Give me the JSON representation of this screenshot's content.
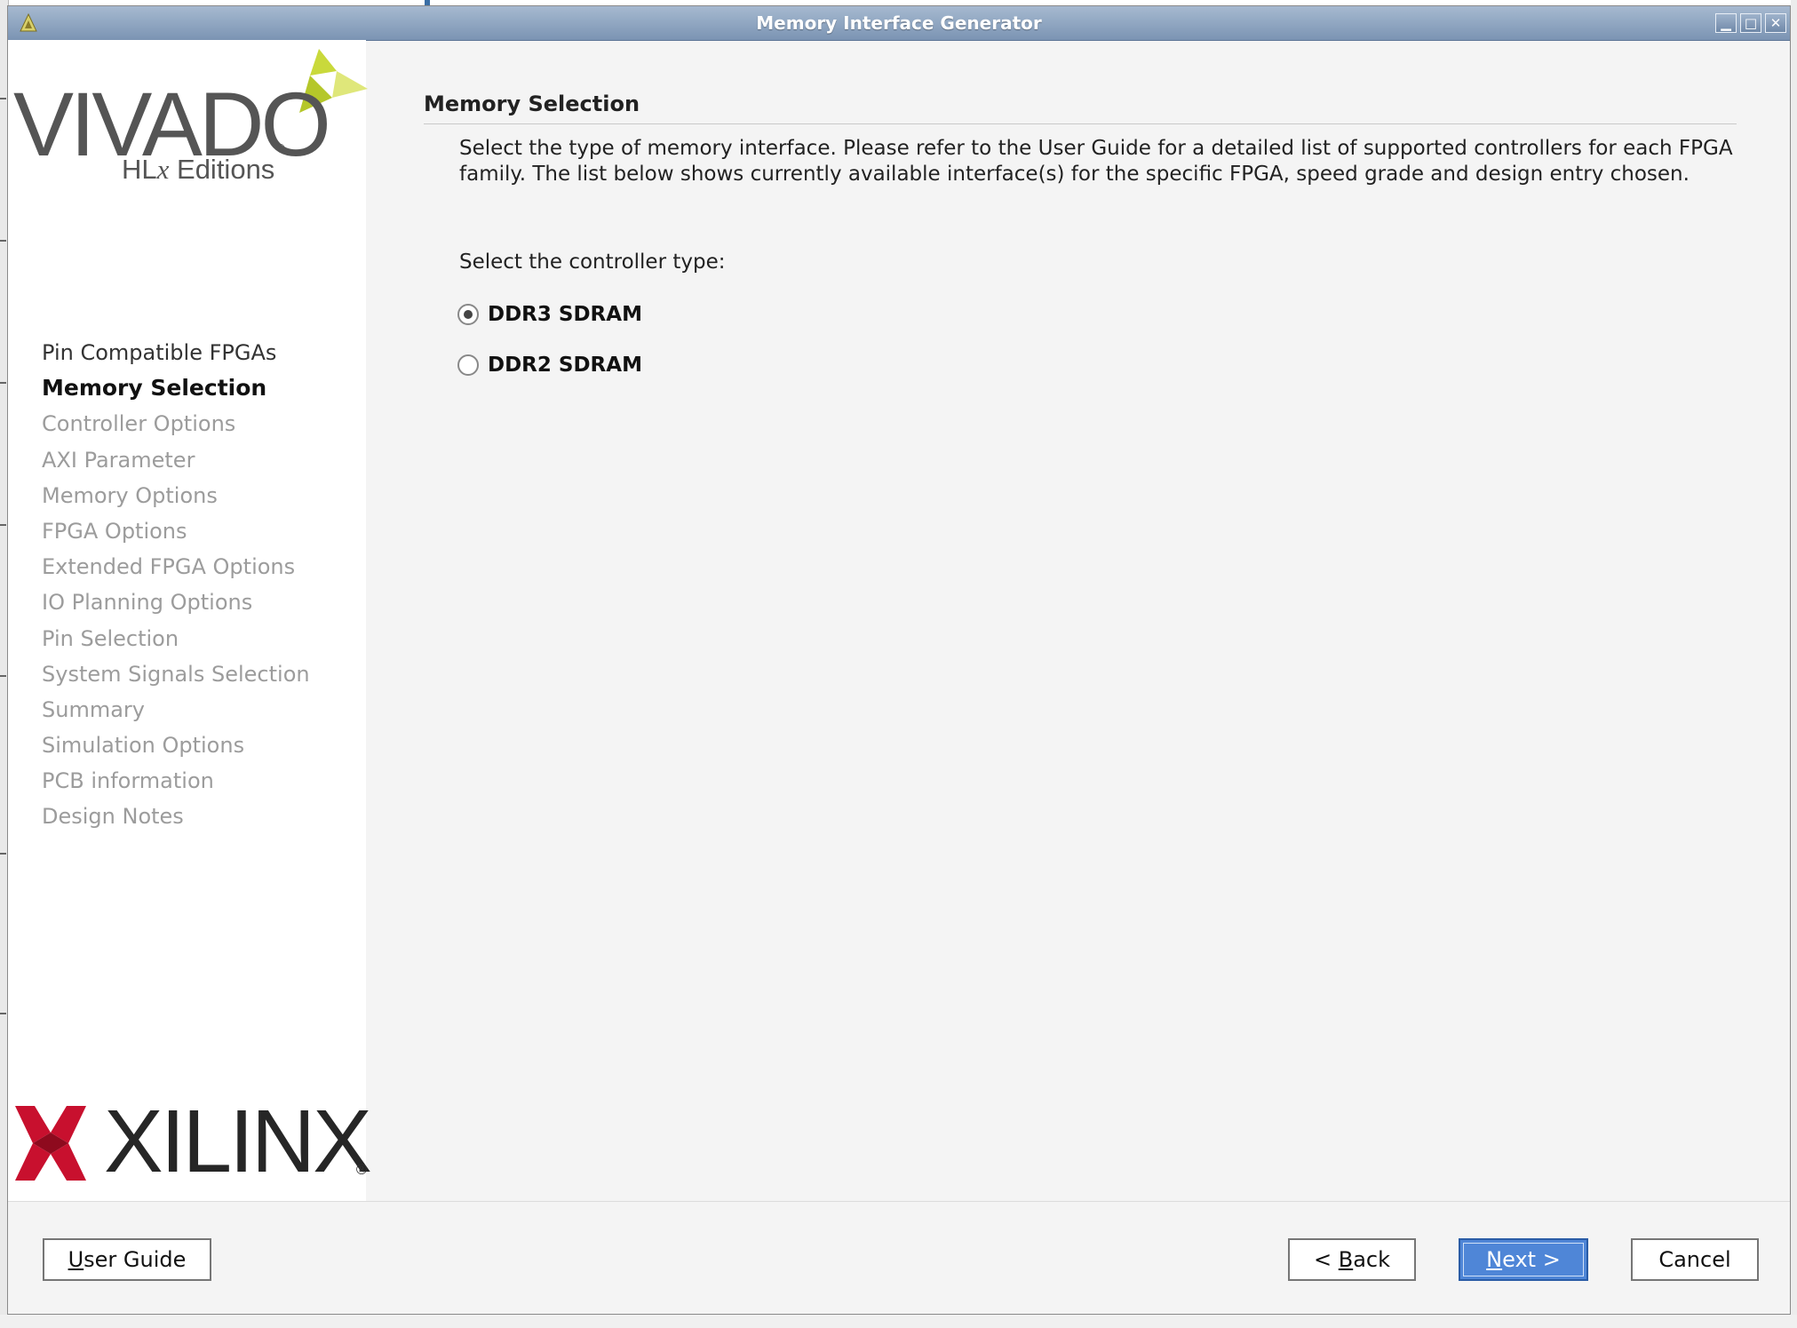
{
  "window": {
    "title": "Memory Interface Generator",
    "controls": {
      "minimize": "▁",
      "maximize": "□",
      "close": "✕"
    }
  },
  "branding": {
    "vivado": "VIVADO",
    "registered": "®",
    "edition_prefix": "HL",
    "edition_x": "x",
    "edition_suffix": " Editions",
    "vendor": "XILINX",
    "vendor_registered": "®",
    "colors": {
      "vivado_triangle": "#c9d93b",
      "xilinx_red": "#c8102e"
    }
  },
  "sidebar": {
    "items": [
      {
        "label": "Pin Compatible FPGAs",
        "state": "done"
      },
      {
        "label": "Memory Selection",
        "state": "current"
      },
      {
        "label": "Controller Options",
        "state": "pending"
      },
      {
        "label": "AXI Parameter",
        "state": "pending"
      },
      {
        "label": "Memory Options",
        "state": "pending"
      },
      {
        "label": "FPGA Options",
        "state": "pending"
      },
      {
        "label": "Extended FPGA Options",
        "state": "pending"
      },
      {
        "label": "IO Planning Options",
        "state": "pending"
      },
      {
        "label": "Pin Selection",
        "state": "pending"
      },
      {
        "label": "System Signals Selection",
        "state": "pending"
      },
      {
        "label": "Summary",
        "state": "pending"
      },
      {
        "label": "Simulation Options",
        "state": "pending"
      },
      {
        "label": "PCB information",
        "state": "pending"
      },
      {
        "label": "Design Notes",
        "state": "pending"
      }
    ]
  },
  "main": {
    "section_title": "Memory Selection",
    "description": "Select the type of memory interface. Please refer to the User Guide for a detailed list of supported controllers for each FPGA family. The list below shows currently available interface(s) for the specific FPGA, speed grade and design entry chosen.",
    "prompt": "Select the controller type:",
    "options": [
      {
        "label": "DDR3 SDRAM",
        "selected": true
      },
      {
        "label": "DDR2 SDRAM",
        "selected": false
      }
    ]
  },
  "footer": {
    "user_guide": {
      "mnemonic": "U",
      "rest": "ser Guide"
    },
    "back": {
      "prefix": "< ",
      "mnemonic": "B",
      "rest": "ack"
    },
    "next": {
      "mnemonic": "N",
      "rest": "ext >"
    },
    "cancel": "Cancel"
  }
}
